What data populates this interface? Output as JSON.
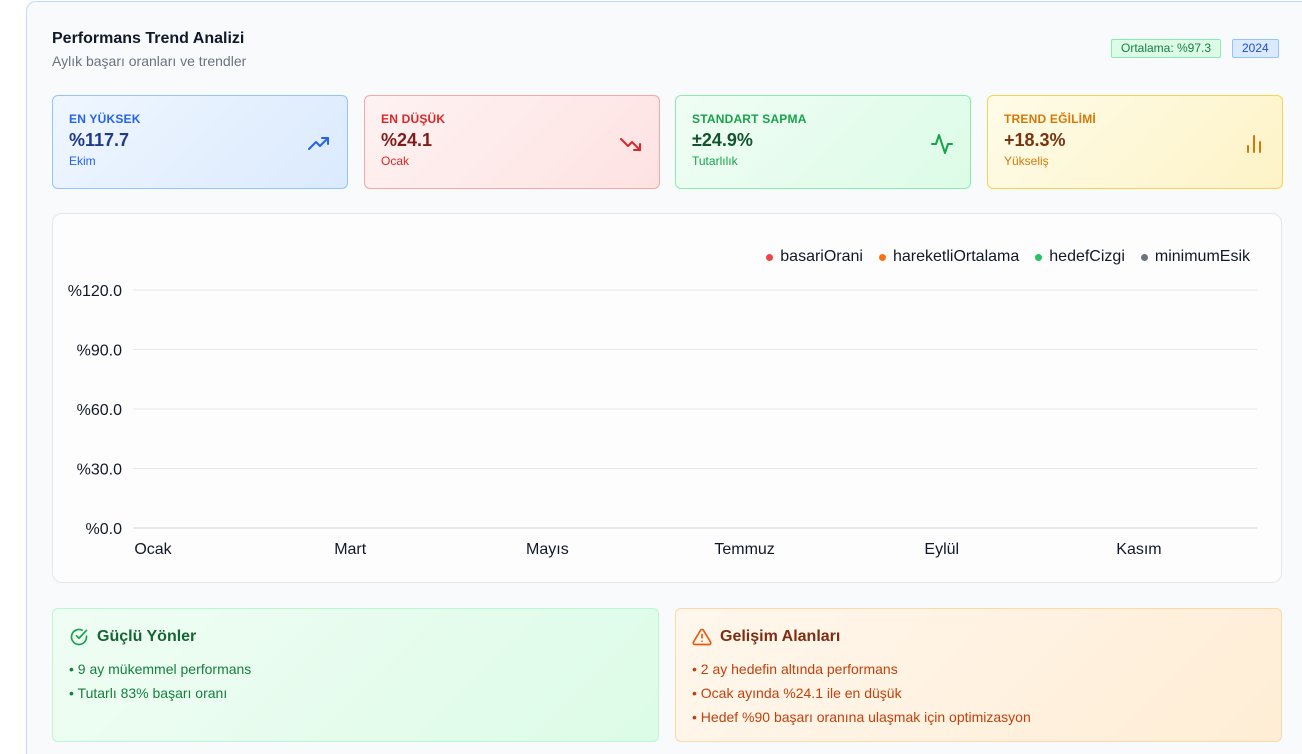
{
  "header": {
    "title": "Performans Trend Analizi",
    "subtitle": "Aylık başarı oranları ve trendler",
    "average_badge": "Ortalama: %97.3",
    "year_badge": "2024"
  },
  "stats": [
    {
      "label": "EN YÜKSEK",
      "value": "%117.7",
      "sub": "Ekim",
      "icon": "trending-up-icon"
    },
    {
      "label": "EN DÜŞÜK",
      "value": "%24.1",
      "sub": "Ocak",
      "icon": "trending-down-icon"
    },
    {
      "label": "STANDART SAPMA",
      "value": "±24.9%",
      "sub": "Tutarlılık",
      "icon": "activity-icon"
    },
    {
      "label": "TREND EĞİLİMİ",
      "value": "+18.3%",
      "sub": "Yükseliş",
      "icon": "bar-chart-icon"
    }
  ],
  "chart_data": {
    "type": "line",
    "x_ticks": [
      "Ocak",
      "Mart",
      "Mayıs",
      "Temmuz",
      "Eylül",
      "Kasım"
    ],
    "y_ticks": [
      "%0.0",
      "%30.0",
      "%60.0",
      "%90.0",
      "%120.0"
    ],
    "ylim": [
      0,
      120
    ],
    "grid": true,
    "legend_position": "top-right",
    "series": [
      {
        "name": "basariOrani",
        "color": "#ef4444",
        "values": []
      },
      {
        "name": "hareketliOrtalama",
        "color": "#f97316",
        "values": []
      },
      {
        "name": "hedefCizgi",
        "color": "#22c55e",
        "values": []
      },
      {
        "name": "minimumEsik",
        "color": "#6b7280",
        "values": []
      }
    ]
  },
  "strengths": {
    "title": "Güçlü Yönler",
    "items": [
      "9 ay mükemmel performans",
      "Tutarlı 83% başarı oranı"
    ]
  },
  "improvements": {
    "title": "Gelişim Alanları",
    "items": [
      "2 ay hedefin altında performans",
      "Ocak ayında %24.1 ile en düşük",
      "Hedef %90 başarı oranına ulaşmak için optimizasyon"
    ]
  }
}
